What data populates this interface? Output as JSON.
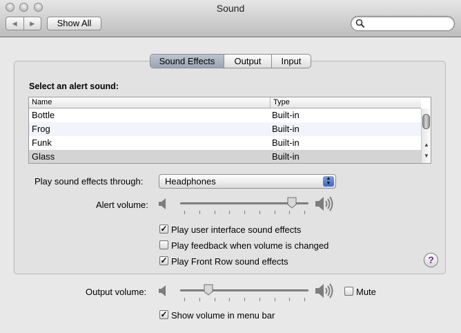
{
  "window": {
    "title": "Sound"
  },
  "toolbar": {
    "back_glyph": "◀",
    "forward_glyph": "▶",
    "show_all_label": "Show All",
    "search_placeholder": ""
  },
  "tabs": [
    {
      "label": "Sound Effects",
      "selected": true
    },
    {
      "label": "Output",
      "selected": false
    },
    {
      "label": "Input",
      "selected": false
    }
  ],
  "alerts": {
    "heading": "Select an alert sound:",
    "columns": [
      "Name",
      "Type"
    ],
    "rows": [
      {
        "name": "Bottle",
        "type": "Built-in"
      },
      {
        "name": "Frog",
        "type": "Built-in"
      },
      {
        "name": "Funk",
        "type": "Built-in"
      },
      {
        "name": "Glass",
        "type": "Built-in",
        "selected": true
      }
    ]
  },
  "sound_effects_through": {
    "label": "Play sound effects through:",
    "value": "Headphones"
  },
  "alert_volume": {
    "label": "Alert volume:",
    "level": 0.9
  },
  "checkboxes": {
    "ui_effects": {
      "label": "Play user interface sound effects",
      "checked": true
    },
    "feedback": {
      "label": "Play feedback when volume is changed",
      "checked": false
    },
    "front_row": {
      "label": "Play Front Row sound effects",
      "checked": true
    }
  },
  "help_glyph": "?",
  "output_volume": {
    "label": "Output volume:",
    "level": 0.2
  },
  "mute": {
    "label": "Mute",
    "checked": false
  },
  "show_in_menu_bar": {
    "label": "Show volume in menu bar",
    "checked": true
  },
  "check_glyph": "✓"
}
